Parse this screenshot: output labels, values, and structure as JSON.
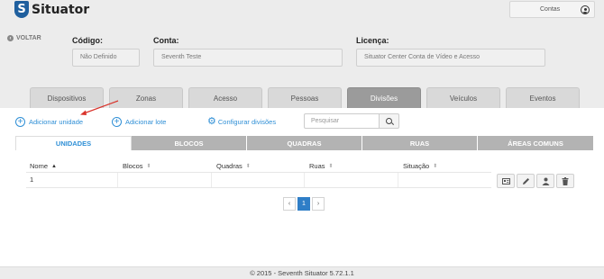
{
  "app": {
    "logo_letter": "S",
    "name": "Situator"
  },
  "header": {
    "account_label": "Contas"
  },
  "back_label": "VOLTAR",
  "fields": {
    "codigo": {
      "label": "Código:",
      "value": "Não Definido"
    },
    "conta": {
      "label": "Conta:",
      "value": "Seventh Teste"
    },
    "licenca": {
      "label": "Licença:",
      "value": "Situator Center Conta de Vídeo e Acesso"
    }
  },
  "tabs": [
    "Dispositivos",
    "Zonas",
    "Acesso",
    "Pessoas",
    "Divisões",
    "Veículos",
    "Eventos"
  ],
  "active_tab": "Divisões",
  "actions": {
    "add_unit": "Adicionar unidade",
    "add_batch": "Adicionar lote",
    "configure": "Configurar divisões"
  },
  "search": {
    "placeholder": "Pesquisar"
  },
  "subtabs": [
    "UNIDADES",
    "BLOCOS",
    "QUADRAS",
    "RUAS",
    "ÁREAS COMUNS"
  ],
  "active_subtab": "UNIDADES",
  "table": {
    "columns": [
      "Nome",
      "Blocos",
      "Quadras",
      "Ruas",
      "Situação"
    ],
    "rows": [
      [
        "1",
        "",
        "",
        "",
        ""
      ]
    ]
  },
  "pagination": {
    "prev": "‹",
    "current": "1",
    "next": "›"
  },
  "footer": "© 2015 - Seventh Situator 5.72.1.1",
  "colors": {
    "accent": "#2f8fd6",
    "logo": "#1f5f9e",
    "arrow": "#d9332b"
  },
  "icons": [
    "user-icon",
    "back-icon",
    "plus-icon",
    "gear-icon",
    "search-icon",
    "id-card-icon",
    "pencil-icon",
    "person-icon",
    "trash-icon"
  ]
}
